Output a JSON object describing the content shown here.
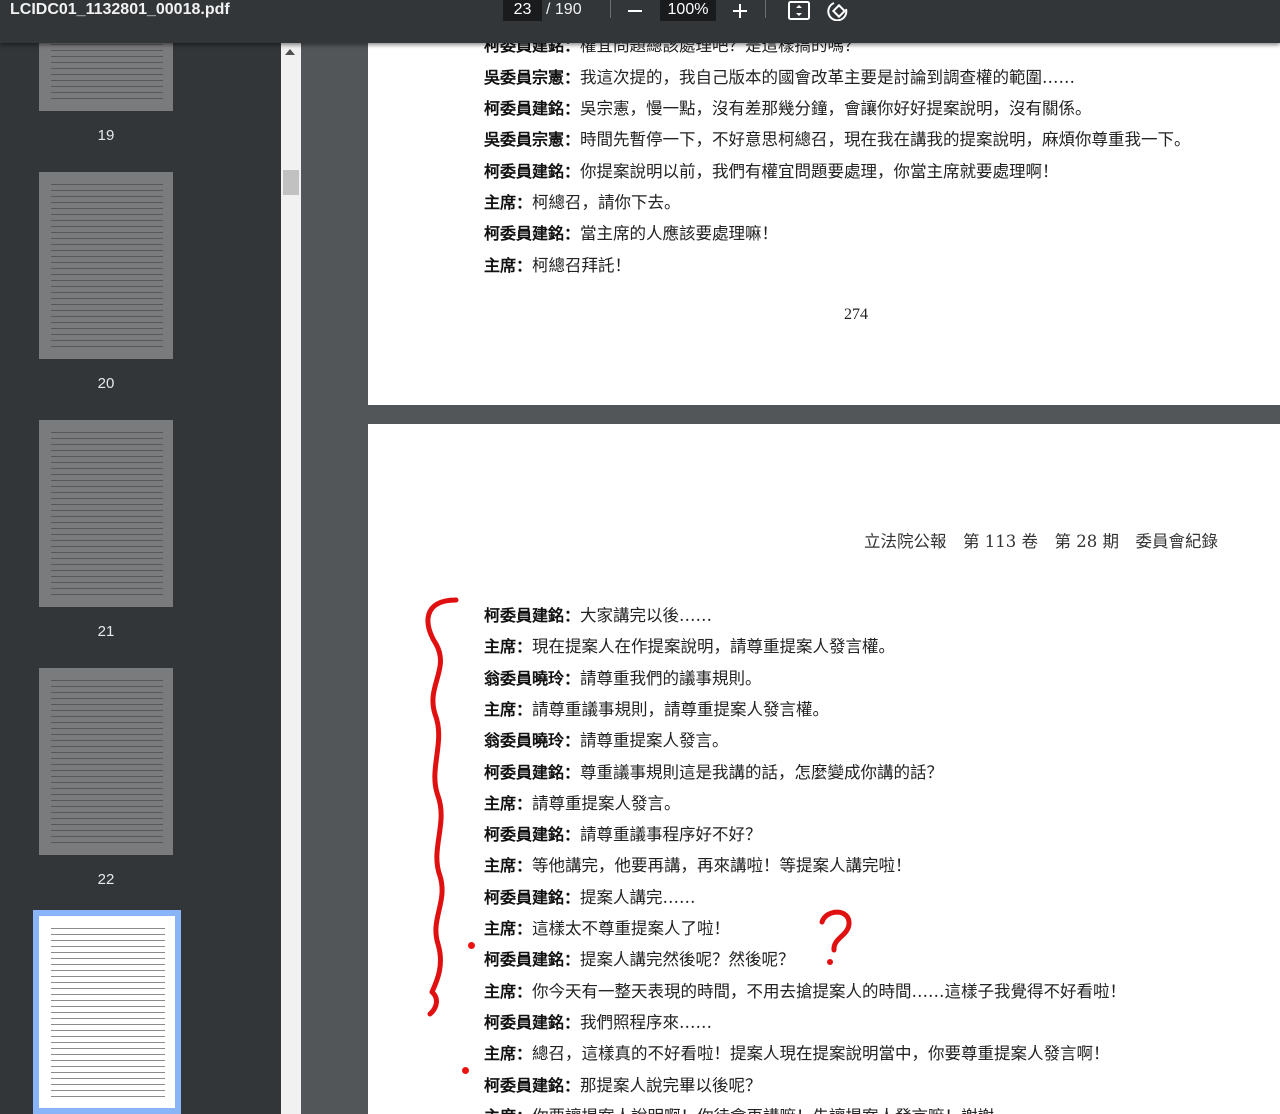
{
  "toolbar": {
    "file_name": "LCIDC01_1132801_00018.pdf",
    "current_page": "23",
    "page_total": "/ 190",
    "zoom": "100%"
  },
  "sidebar": {
    "thumbnails": [
      {
        "number": "19"
      },
      {
        "number": "20"
      },
      {
        "number": "21"
      },
      {
        "number": "22"
      },
      {
        "number": "23",
        "selected": true
      }
    ]
  },
  "page_top": {
    "clipped_line": {
      "speaker": "柯委員建銘",
      "text": "權宜問題總該處理吧？是這樣搞的嗎？"
    },
    "lines": [
      {
        "speaker": "吳委員宗憲",
        "text": "我這次提的，我自己版本的國會改革主要是討論到調查權的範圍……"
      },
      {
        "speaker": "柯委員建銘",
        "text": "吳宗憲，慢一點，沒有差那幾分鐘，會讓你好好提案說明，沒有關係。"
      },
      {
        "speaker": "吳委員宗憲",
        "text": "時間先暫停一下，不好意思柯總召，現在我在講我的提案說明，麻煩你尊重我一下。"
      },
      {
        "speaker": "柯委員建銘",
        "text": "你提案說明以前，我們有權宜問題要處理，你當主席就要處理啊！"
      },
      {
        "speaker": "主席",
        "text": "柯總召，請你下去。"
      },
      {
        "speaker": "柯委員建銘",
        "text": "當主席的人應該要處理嘛！"
      },
      {
        "speaker": "主席",
        "text": "柯總召拜託！"
      }
    ],
    "page_number": "274"
  },
  "page_bottom": {
    "header": "立法院公報　第 113 卷　第 28 期　委員會紀錄",
    "lines": [
      {
        "speaker": "柯委員建銘",
        "text": "大家講完以後……"
      },
      {
        "speaker": "主席",
        "text": "現在提案人在作提案說明，請尊重提案人發言權。"
      },
      {
        "speaker": "翁委員曉玲",
        "text": "請尊重我們的議事規則。"
      },
      {
        "speaker": "主席",
        "text": "請尊重議事規則，請尊重提案人發言權。"
      },
      {
        "speaker": "翁委員曉玲",
        "text": "請尊重提案人發言。"
      },
      {
        "speaker": "柯委員建銘",
        "text": "尊重議事規則這是我講的話，怎麼變成你講的話？"
      },
      {
        "speaker": "主席",
        "text": "請尊重提案人發言。"
      },
      {
        "speaker": "柯委員建銘",
        "text": "請尊重議事程序好不好？"
      },
      {
        "speaker": "主席",
        "text": "等他講完，他要再講，再來講啦！等提案人講完啦！"
      },
      {
        "speaker": "柯委員建銘",
        "text": "提案人講完……"
      },
      {
        "speaker": "主席",
        "text": "這樣太不尊重提案人了啦！"
      },
      {
        "speaker": "柯委員建銘",
        "text": "提案人講完然後呢？然後呢？"
      },
      {
        "speaker": "主席",
        "text": "你今天有一整天表現的時間，不用去搶提案人的時間……這樣子我覺得不好看啦！"
      },
      {
        "speaker": "柯委員建銘",
        "text": "我們照程序來……"
      },
      {
        "speaker": "主席",
        "text": "總召，這樣真的不好看啦！提案人現在提案說明當中，你要尊重提案人發言啊！"
      },
      {
        "speaker": "柯委員建銘",
        "text": "那提案人說完畢以後呢？"
      },
      {
        "speaker": "主席",
        "text": "你要讓提案人說明啊！你待會再講嘛！先讓提案人發言嘛！謝謝。"
      }
    ]
  },
  "annotations": {
    "color": "#e01010",
    "question_mark": "?"
  },
  "icons": [
    "minus-icon",
    "plus-icon",
    "fit-page-icon",
    "rotate-icon",
    "scroll-up-arrow-icon"
  ]
}
